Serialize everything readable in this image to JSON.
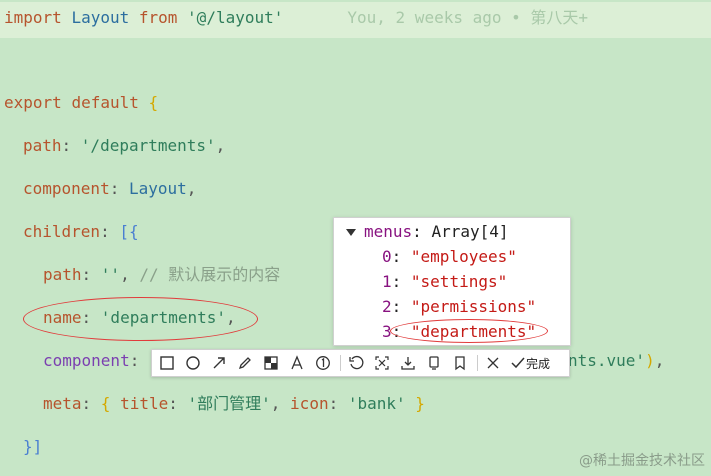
{
  "code": {
    "l1_kw": "import",
    "l1_name": "Layout",
    "l1_from": "from",
    "l1_path": "'@/layout'",
    "l1_blame": "You, 2 weeks ago • 第八天+",
    "l2_export": "export",
    "l2_default": "default",
    "l2_brace": "{",
    "path_key": "path",
    "path_val": "'/departments'",
    "component_key": "component",
    "component_val": "Layout",
    "children_key": "children",
    "children_open": "[{",
    "inner_path_key": "path",
    "inner_path_val": "''",
    "inner_path_comment": "// 默认展示的内容",
    "name_key": "name",
    "name_val": "'departments'",
    "inner_component_key": "component",
    "inner_component_tail": "nts.vue'",
    "meta_key": "meta",
    "title_key": "title",
    "title_val": "'部门管理'",
    "icon_key": "icon",
    "icon_val": "'bank'",
    "children_close": "}]"
  },
  "devtools": {
    "menus_key": "menus",
    "menus_type": "Array[4]",
    "items": [
      {
        "index": "0",
        "value": "\"employees\""
      },
      {
        "index": "1",
        "value": "\"settings\""
      },
      {
        "index": "2",
        "value": "\"permissions\""
      },
      {
        "index": "3",
        "value": "\"departments\""
      }
    ]
  },
  "toolbar": {
    "tools": [
      "rectangle-icon",
      "ellipse-icon",
      "arrow-icon",
      "pen-icon",
      "mosaic-icon",
      "text-icon",
      "number-icon",
      "undo-icon",
      "crop-icon",
      "download-icon",
      "pin-icon",
      "bookmark-icon"
    ],
    "cancel_label": "",
    "done_label": "完成"
  },
  "watermark": "@稀土掘金技术社区",
  "colors": {
    "annotation": "#e13b3b",
    "background": "#c7e6c7"
  }
}
